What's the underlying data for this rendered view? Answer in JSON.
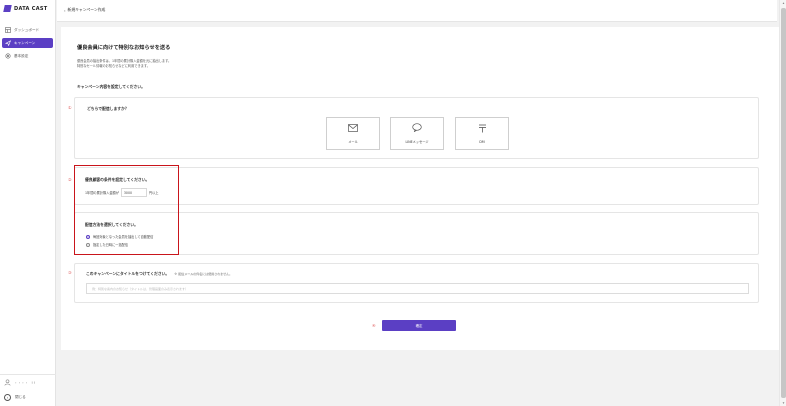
{
  "app": {
    "brand": "DATA CAST"
  },
  "sidebar": {
    "items": [
      {
        "label": "ダッシュボード",
        "icon": "dashboard-icon",
        "active": false
      },
      {
        "label": "キャンペーン",
        "icon": "campaign-icon",
        "active": true
      },
      {
        "label": "基本設定",
        "icon": "gear-icon",
        "active": false
      }
    ],
    "user_label": "・・・・",
    "user_suffix": "!  !",
    "close_label": "閉じる"
  },
  "header": {
    "back_label": "新規キャンペーン作成"
  },
  "main": {
    "title": "優良会員に向けて特別なお知らせを送る",
    "description_lines": [
      "優良会員の抽出条件は、1年間の累計購入金額を元に抽出します。",
      "特別なセール情報のお知らせなどに利用できます。"
    ],
    "section_label": "キャンペーン内容を設定してください。",
    "step1": {
      "number": "①",
      "question": "どちらで配信しますか？",
      "options": [
        {
          "label": "メール",
          "icon": "mail-icon"
        },
        {
          "label": "LINEメッセージ",
          "icon": "chat-bubble-icon"
        },
        {
          "label": "DM",
          "icon": "postal-icon"
        }
      ]
    },
    "step2": {
      "number": "②",
      "condition_title": "優良顧客の条件を設定してください。",
      "condition_prefix": "1年間の累計購入金額が",
      "condition_value": "3000",
      "condition_suffix": "円以上",
      "method_title": "配信方法を選択してください。",
      "methods": [
        {
          "label": "毎回対象となった会員を抽出して自動配信",
          "selected": true
        },
        {
          "label": "指定した日時に一括配信",
          "selected": false
        }
      ]
    },
    "step3": {
      "number": "③",
      "question": "このキャンペーンにタイトルをつけてください。",
      "note": "※ 配信メールの件名には使用されません。",
      "input_placeholder": "例：特別な案内のお知らせ（タイトルは、管理画面のみ表示されます）"
    },
    "step4": {
      "number": "④",
      "submit_label": "確定"
    }
  },
  "colors": {
    "accent": "#5b3fc4",
    "highlight": "#c9151b",
    "step_number": "#e06060"
  }
}
